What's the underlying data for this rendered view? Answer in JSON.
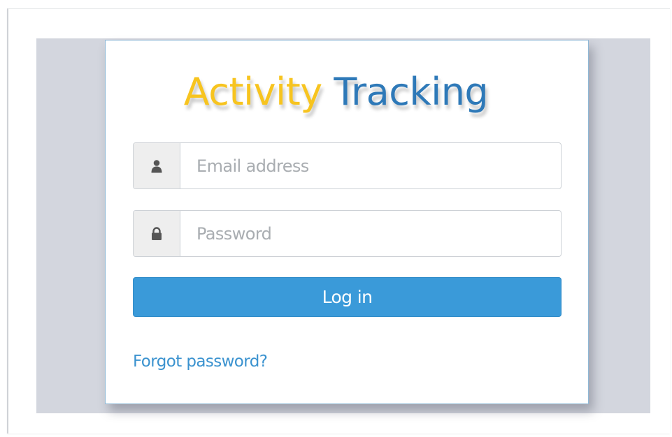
{
  "app": {
    "title_part1": "Activity",
    "title_part2": "Tracking"
  },
  "login_form": {
    "email": {
      "placeholder": "Email address",
      "value": "",
      "icon": "user-icon"
    },
    "password": {
      "placeholder": "Password",
      "value": "",
      "icon": "lock-icon"
    },
    "login_button_label": "Log in",
    "forgot_password_label": "Forgot password?"
  },
  "colors": {
    "title_part1": "#f7c41f",
    "title_part2": "#2e79b8",
    "login_button": "#3a9ad9",
    "link": "#3a92cf",
    "backdrop": "#d3d6de"
  }
}
